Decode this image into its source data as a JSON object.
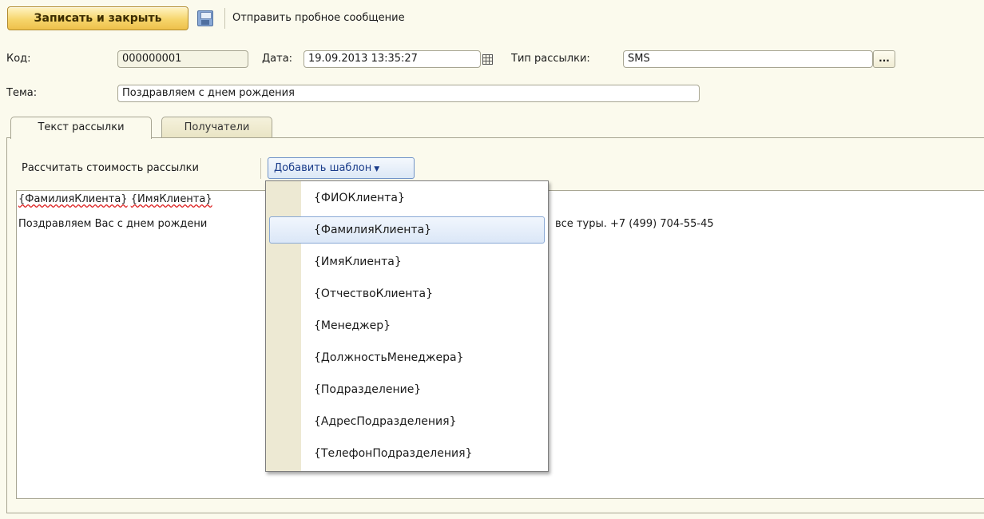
{
  "toolbar": {
    "save_close_label": "Записать и закрыть",
    "save_icon": "floppy-disk-icon",
    "send_test_label": "Отправить пробное сообщение"
  },
  "form": {
    "code_label": "Код:",
    "code_value": "000000001",
    "date_label": "Дата:",
    "date_value": "19.09.2013 13:35:27",
    "type_label": "Тип рассылки:",
    "type_value": "SMS",
    "type_select_label": "...",
    "subject_label": "Тема:",
    "subject_value": "Поздравляем с днем рождения"
  },
  "tabs": [
    {
      "label": "Текст рассылки",
      "active": true
    },
    {
      "label": "Получатели",
      "active": false
    }
  ],
  "panel": {
    "calc_cost_label": "Рассчитать стоимость рассылки",
    "add_template_label": "Добавить шаблон"
  },
  "editor": {
    "line1_a": "{ФамилияКлиента}",
    "line1_b": "{ИмяКлиента}",
    "line2_a": "Поздравляем Вас с днем рождени",
    "line2_b": "все туры. +7 (499) 704-55-45"
  },
  "dropdown": {
    "hovered_index": 1,
    "items": [
      "{ФИОКлиента}",
      "{ФамилияКлиента}",
      "{ИмяКлиента}",
      "{ОтчествоКлиента}",
      "{Менеджер}",
      "{ДолжностьМенеджера}",
      "{Подразделение}",
      "{АдресПодразделения}",
      "{ТелефонПодразделения}"
    ]
  },
  "colors": {
    "background": "#fbfaed",
    "primary_button": "#f6d56c",
    "link_blue": "#1a3c8a",
    "hover_blue": "#dbe7f7"
  }
}
